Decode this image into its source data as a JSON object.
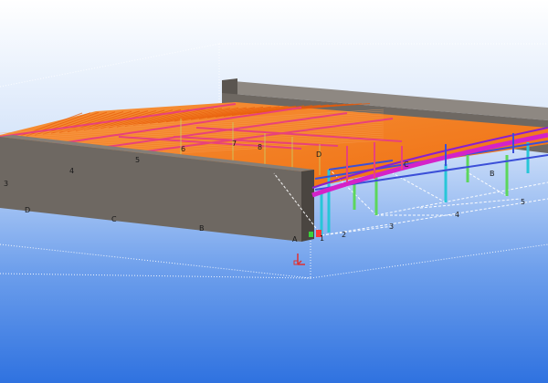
{
  "viewport": {
    "background_top": "#ffffff",
    "background_bottom": "#2f72e0",
    "wall_color": "#6e6862",
    "roof_color": "#f47a1e",
    "truss_color": "#e8427a",
    "column_cyan": "#27c6d8",
    "column_green": "#5cd65c",
    "beam_blue": "#3b4fd8",
    "arch_magenta": "#d422c8",
    "axis_icon": "coordinate-axis-icon"
  },
  "grid_labels": {
    "wall_front": [
      "3",
      "4",
      "5",
      "D",
      "C",
      "B",
      "A"
    ],
    "roof": [
      "6",
      "7",
      "8",
      "D",
      "C"
    ],
    "frame": [
      "1",
      "2",
      "3",
      "4",
      "5",
      "B"
    ]
  }
}
